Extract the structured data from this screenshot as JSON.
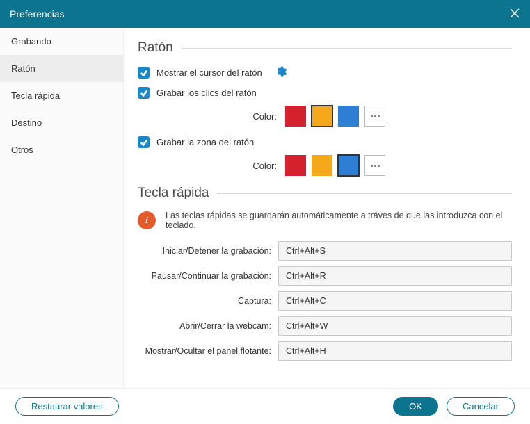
{
  "window": {
    "title": "Preferencias"
  },
  "sidebar": {
    "items": [
      {
        "label": "Grabando"
      },
      {
        "label": "Ratón"
      },
      {
        "label": "Tecla rápida"
      },
      {
        "label": "Destino"
      },
      {
        "label": "Otros"
      }
    ],
    "active_index": 1
  },
  "mouse": {
    "title": "Ratón",
    "show_cursor_label": "Mostrar el cursor del ratón",
    "record_clicks_label": "Grabar los clics del ratón",
    "record_zone_label": "Grabar la zona del ratón",
    "color_label": "Color:",
    "click_colors": [
      "#d3212d",
      "#f4a81c",
      "#2e7ed6"
    ],
    "click_selected_index": 1,
    "zone_colors": [
      "#d3212d",
      "#f4a81c",
      "#2e7ed6"
    ],
    "zone_selected_index": 2
  },
  "hotkey": {
    "title": "Tecla rápida",
    "info": "Las teclas rápidas se guardarán automáticamente a tráves de que las introduzca con el teclado.",
    "rows": [
      {
        "label": "Iniciar/Detener la grabación:",
        "value": "Ctrl+Alt+S"
      },
      {
        "label": "Pausar/Continuar la grabación:",
        "value": "Ctrl+Alt+R"
      },
      {
        "label": "Captura:",
        "value": "Ctrl+Alt+C"
      },
      {
        "label": "Abrir/Cerrar la webcam:",
        "value": "Ctrl+Alt+W"
      },
      {
        "label": "Mostrar/Ocultar el panel flotante:",
        "value": "Ctrl+Alt+H"
      }
    ]
  },
  "footer": {
    "restore": "Restaurar valores",
    "ok": "OK",
    "cancel": "Cancelar"
  }
}
